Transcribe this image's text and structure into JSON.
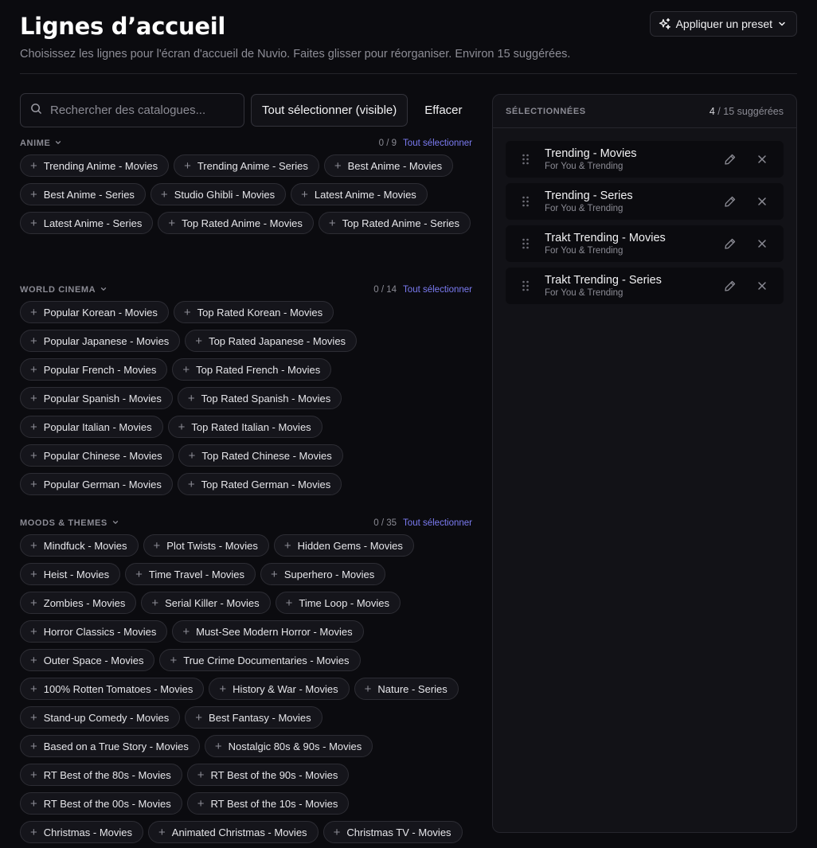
{
  "header": {
    "title": "Lignes d’accueil",
    "subtitle": "Choisissez les lignes pour l'écran d'accueil de Nuvio. Faites glisser pour réorganiser. Environ 15 suggérées.",
    "preset_button": "Appliquer un preset"
  },
  "toolbar": {
    "search_placeholder": "Rechercher des catalogues...",
    "select_all_visible": "Tout sélectionner (visible)",
    "clear": "Effacer"
  },
  "groups": [
    {
      "title": "ANIME",
      "count": "0 / 9",
      "select_all": "Tout sélectionner",
      "items": [
        "Trending Anime - Movies",
        "Trending Anime - Series",
        "Best Anime - Movies",
        "Best Anime - Series",
        "Studio Ghibli - Movies",
        "Latest Anime - Movies",
        "Latest Anime - Series",
        "Top Rated Anime - Movies",
        "Top Rated Anime - Series"
      ]
    },
    {
      "title": "WORLD CINEMA",
      "count": "0 / 14",
      "select_all": "Tout sélectionner",
      "items": [
        "Popular Korean - Movies",
        "Top Rated Korean - Movies",
        "Popular Japanese - Movies",
        "Top Rated Japanese - Movies",
        "Popular French - Movies",
        "Top Rated French - Movies",
        "Popular Spanish - Movies",
        "Top Rated Spanish - Movies",
        "Popular Italian - Movies",
        "Top Rated Italian - Movies",
        "Popular Chinese - Movies",
        "Top Rated Chinese - Movies",
        "Popular German - Movies",
        "Top Rated German - Movies"
      ]
    },
    {
      "title": "MOODS & THEMES",
      "count": "0 / 35",
      "select_all": "Tout sélectionner",
      "items": [
        "Mindfuck - Movies",
        "Plot Twists - Movies",
        "Hidden Gems - Movies",
        "Heist - Movies",
        "Time Travel - Movies",
        "Superhero - Movies",
        "Zombies - Movies",
        "Serial Killer - Movies",
        "Time Loop - Movies",
        "Horror Classics - Movies",
        "Must-See Modern Horror - Movies",
        "Outer Space - Movies",
        "True Crime Documentaries - Movies",
        "100% Rotten Tomatoes - Movies",
        "History & War - Movies",
        "Nature - Series",
        "Stand-up Comedy - Movies",
        "Best Fantasy - Movies",
        "Based on a True Story - Movies",
        "Nostalgic 80s & 90s - Movies",
        "RT Best of the 80s - Movies",
        "RT Best of the 90s - Movies",
        "RT Best of the 00s - Movies",
        "RT Best of the 10s - Movies",
        "Christmas - Movies",
        "Animated Christmas - Movies",
        "Christmas TV - Movies"
      ]
    }
  ],
  "selected": {
    "title": "SÉLECTIONNÉES",
    "count": "4",
    "suggested": "/ 15 suggérées",
    "items": [
      {
        "name": "Trending - Movies",
        "source": "For You & Trending"
      },
      {
        "name": "Trending - Series",
        "source": "For You & Trending"
      },
      {
        "name": "Trakt Trending - Movies",
        "source": "For You & Trending"
      },
      {
        "name": "Trakt Trending - Series",
        "source": "For You & Trending"
      }
    ]
  },
  "icons": {
    "preset": "sparkles-icon",
    "preset_caret": "chevron-down-icon",
    "search": "search-icon",
    "group_caret": "chevron-down-icon",
    "chip": "plus-icon",
    "drag": "drag-handle-icon",
    "edit": "pencil-icon",
    "remove": "close-icon"
  },
  "colors": {
    "background": "#0b0b0f",
    "panel": "#121217",
    "accent_link": "#7b7bf2"
  }
}
